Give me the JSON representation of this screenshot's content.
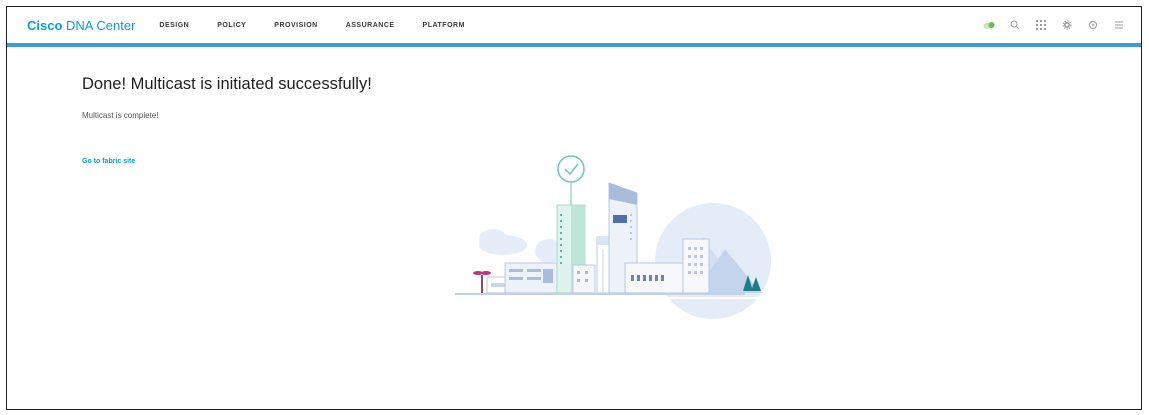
{
  "header": {
    "brand_bold": "Cisco",
    "brand_light": " DNA Center",
    "nav": [
      "DESIGN",
      "POLICY",
      "PROVISION",
      "ASSURANCE",
      "PLATFORM"
    ],
    "icons": [
      "cloud-status-icon",
      "search-icon",
      "apps-grid-icon",
      "settings-icon",
      "system-health-icon",
      "menu-icon"
    ]
  },
  "main": {
    "title": "Done! Multicast is initiated successfully!",
    "message": "Multicast is complete!",
    "link": "Go to fabric site"
  },
  "colors": {
    "accent": "#049fd9",
    "header_border": "#3c9ad6",
    "status_green": "#6abf4b"
  }
}
